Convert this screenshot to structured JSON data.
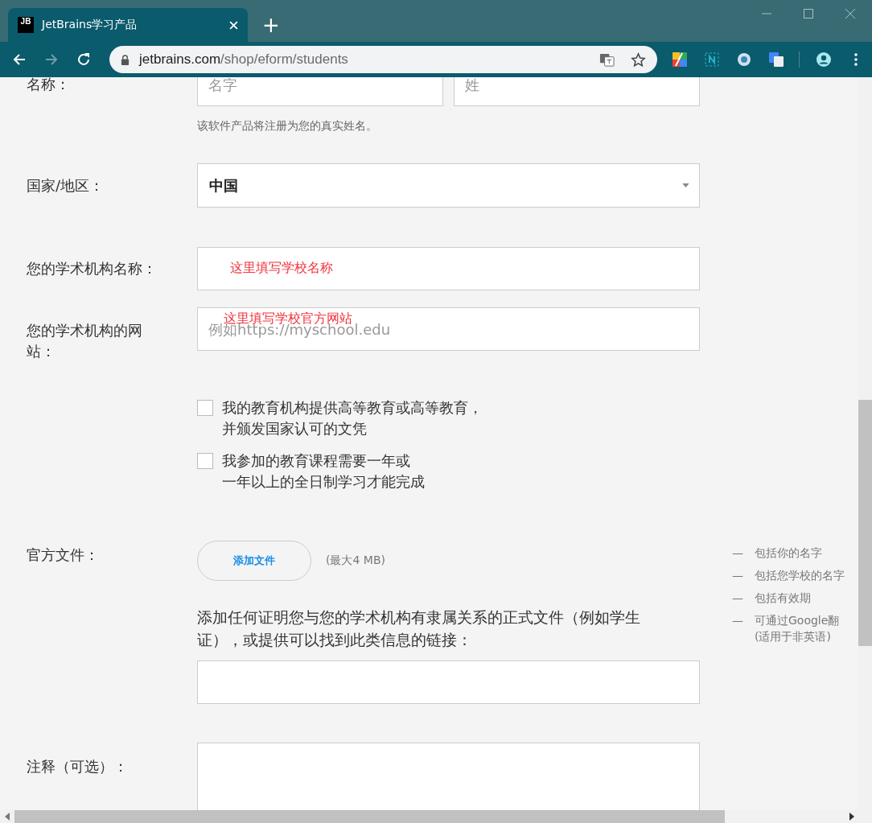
{
  "browser": {
    "tab": {
      "favicon": "JB",
      "title": "JetBrains学习产品"
    },
    "new_tab": "+",
    "url": {
      "host": "jetbrains.com",
      "path": "/shop/eform/students"
    }
  },
  "form": {
    "name": {
      "label": "名称：",
      "first_placeholder": "名字",
      "last_placeholder": "姓",
      "hint": "该软件产品将注册为您的真实姓名。"
    },
    "country": {
      "label": "国家/地区：",
      "value": "中国"
    },
    "institution": {
      "label": "您的学术机构名称：",
      "annotation": "这里填写学校名称"
    },
    "website": {
      "label": "您的学术机构的网站：",
      "placeholder": "例如https://myschool.edu",
      "annotation": "这里填写学校官方网站"
    },
    "checkboxes": [
      {
        "lines": [
          "我的教育机构提供高等教育或高等教育，",
          "并颁发国家认可的文凭"
        ],
        "checked": false
      },
      {
        "lines": [
          "我参加的教育课程需要一年或",
          "一年以上的全日制学习才能完成"
        ],
        "checked": false
      }
    ],
    "documents": {
      "label": "官方文件：",
      "button": "添加文件",
      "limit": "(最大4 MB)",
      "description": "添加任何证明您与您的学术机构有隶属关系的正式文件（例如学生证），或提供可以找到此类信息的链接：",
      "tips": [
        {
          "dash": "—",
          "text": "包括你的名字"
        },
        {
          "dash": "—",
          "text": "包括您学校的名字"
        },
        {
          "dash": "—",
          "text": "包括有效期"
        },
        {
          "dash": "—",
          "text": "可通过Google翻\n(适用于非英语)"
        }
      ]
    },
    "notes": {
      "label": "注释（可选）："
    }
  }
}
